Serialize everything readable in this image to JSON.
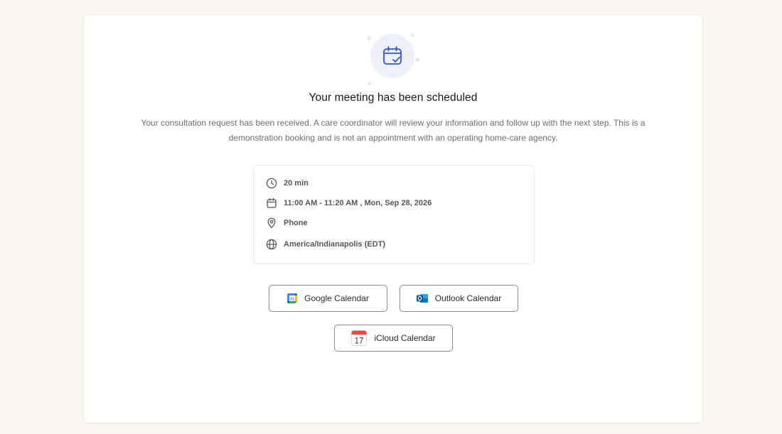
{
  "confirmation": {
    "title": "Your meeting has been scheduled",
    "description": "Your consultation request has been received. A care coordinator will review your information and follow up with the next step. This is a demonstration booking and is not an appointment with an operating home-care agency.",
    "accent_color": "#2f55d4"
  },
  "details": {
    "duration": "20 min",
    "datetime": "11:00 AM - 11:20 AM , Mon, Sep 28, 2026",
    "location": "Phone",
    "timezone": "America/Indianapolis (EDT)"
  },
  "calendar_buttons": {
    "google": "Google Calendar",
    "outlook": "Outlook Calendar",
    "icloud": "iCloud Calendar",
    "icloud_day": "17"
  }
}
